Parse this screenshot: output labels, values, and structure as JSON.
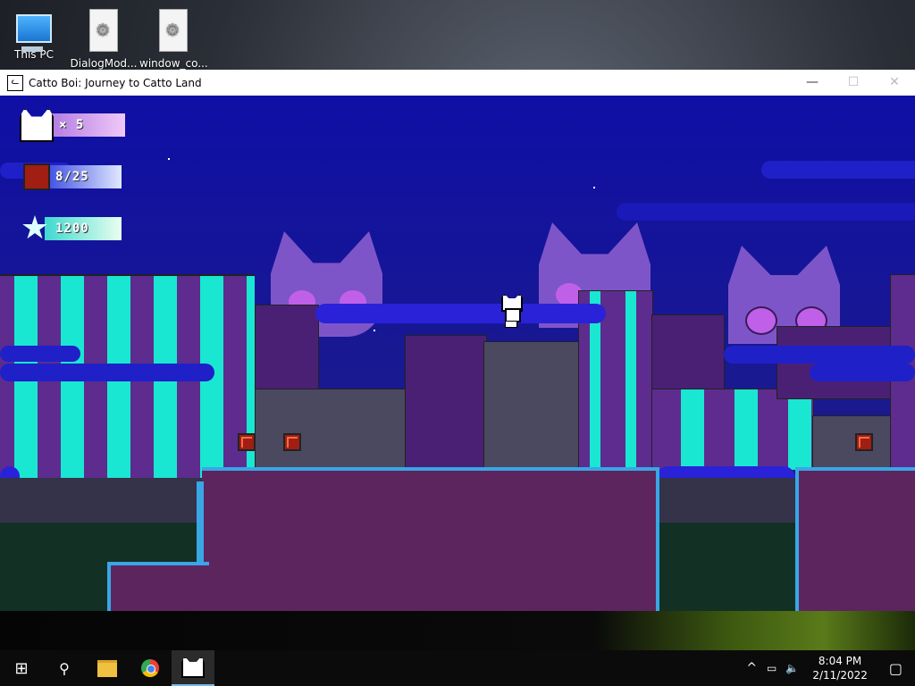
{
  "desktop": {
    "icons": [
      {
        "label": "This PC"
      },
      {
        "label": "DialogMod..."
      },
      {
        "label": "window_co..."
      }
    ]
  },
  "window": {
    "title": "Catto Boi: Journey to Catto Land",
    "controls": {
      "minimize": "—",
      "maximize": "☐",
      "close": "✕"
    }
  },
  "hud": {
    "lives": "× 5",
    "crates": "8/25",
    "score": "1200"
  },
  "taskbar": {
    "time": "8:04 PM",
    "date": "2/11/2022",
    "tray_chevron": "^",
    "apps": [
      {
        "name": "Start"
      },
      {
        "name": "Search"
      },
      {
        "name": "File Explorer"
      },
      {
        "name": "Chrome"
      },
      {
        "name": "Catto Boi"
      }
    ]
  },
  "colors": {
    "sky": "#0f0fa5",
    "building_purple": "#5d2c8e",
    "window_cyan": "#19e7d2",
    "ground": "#5d255e",
    "grass_edge": "#39a6e6",
    "crate": "#a01e12",
    "cat_ghost": "#7e55c8"
  }
}
